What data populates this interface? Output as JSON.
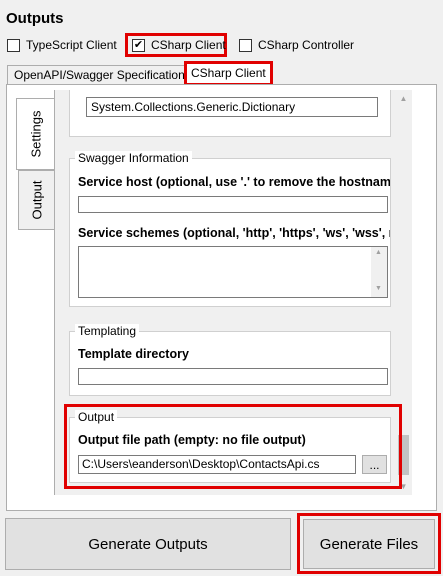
{
  "outputs_title": "Outputs",
  "checkboxes": [
    {
      "label": "TypeScript Client",
      "checked": false
    },
    {
      "label": "CSharp Client",
      "checked": true
    },
    {
      "label": "CSharp Controller",
      "checked": false
    }
  ],
  "check_glyph": "✔",
  "tabs": [
    {
      "label": "OpenAPI/Swagger Specification",
      "selected": false
    },
    {
      "label": "CSharp Client",
      "selected": true
    }
  ],
  "side_tabs": [
    {
      "label": "Settings",
      "selected": true
    },
    {
      "label": "Output",
      "selected": false
    }
  ],
  "dictionary_type_value": "System.Collections.Generic.Dictionary",
  "swagger_group": {
    "title": "Swagger Information",
    "service_host_label": "Service host (optional, use '.' to remove the hostname)",
    "service_host_value": "",
    "service_schemes_label": "Service schemes (optional, 'http', 'https', 'ws', 'wss', mu",
    "service_schemes_value": ""
  },
  "templating_group": {
    "title": "Templating",
    "template_dir_label": "Template directory",
    "template_dir_value": ""
  },
  "output_group": {
    "title": "Output",
    "output_path_label": "Output file path (empty: no file output)",
    "output_path_value": "C:\\Users\\eanderson\\Desktop\\ContactsApi.cs",
    "browse_label": "..."
  },
  "buttons": {
    "generate_outputs": "Generate Outputs",
    "generate_files": "Generate Files"
  },
  "highlight_color": "#e00000"
}
